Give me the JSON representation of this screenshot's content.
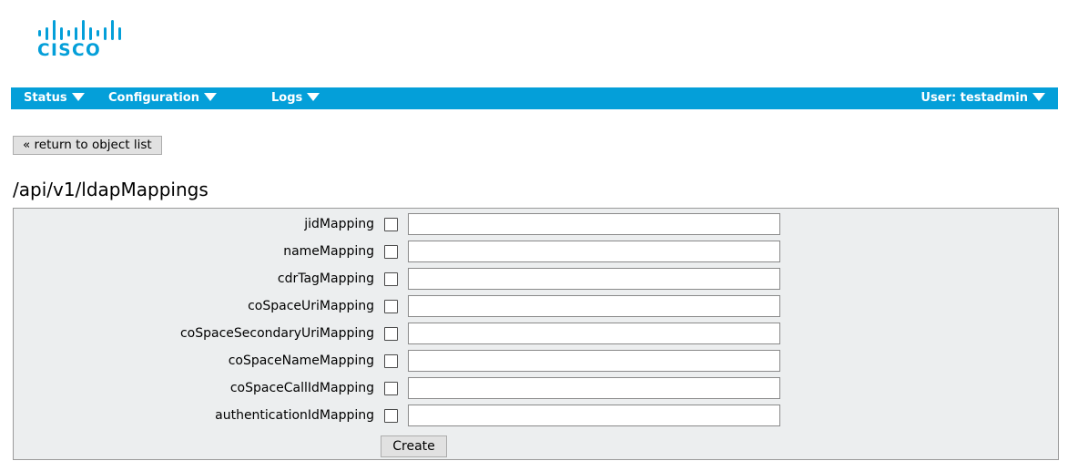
{
  "brand": {
    "logo_text": "CISCO",
    "color": "#049fd9"
  },
  "nav": {
    "items": [
      {
        "label": "Status",
        "icon": "triangle-down-icon"
      },
      {
        "label": "Configuration",
        "icon": "triangle-down-icon"
      },
      {
        "label": "Logs",
        "icon": "triangle-down-icon"
      }
    ],
    "user_label": "User: testadmin",
    "bar_color": "#049fd9"
  },
  "return_button": {
    "label": "« return to object list"
  },
  "page": {
    "title": "/api/v1/ldapMappings"
  },
  "form": {
    "fields": [
      {
        "label": "jidMapping",
        "checked": false,
        "value": ""
      },
      {
        "label": "nameMapping",
        "checked": false,
        "value": ""
      },
      {
        "label": "cdrTagMapping",
        "checked": false,
        "value": ""
      },
      {
        "label": "coSpaceUriMapping",
        "checked": false,
        "value": ""
      },
      {
        "label": "coSpaceSecondaryUriMapping",
        "checked": false,
        "value": ""
      },
      {
        "label": "coSpaceNameMapping",
        "checked": false,
        "value": ""
      },
      {
        "label": "coSpaceCallIdMapping",
        "checked": false,
        "value": ""
      },
      {
        "label": "authenticationIdMapping",
        "checked": false,
        "value": ""
      }
    ],
    "submit_label": "Create"
  }
}
